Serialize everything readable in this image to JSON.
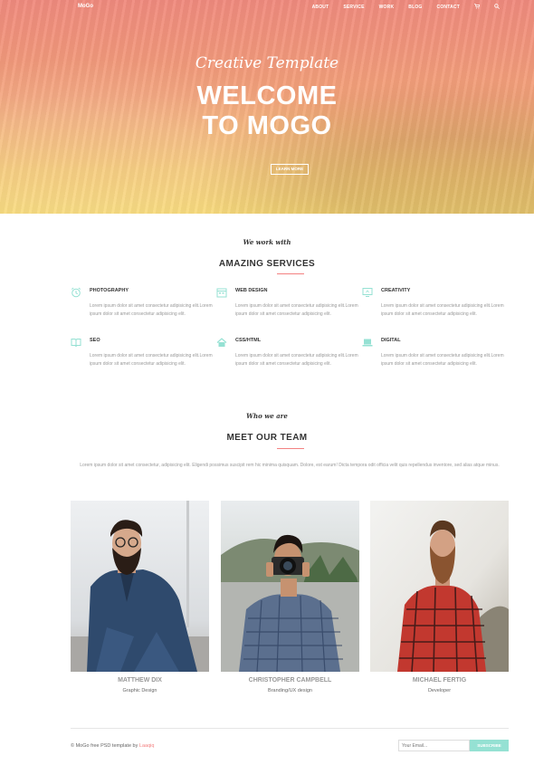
{
  "nav": {
    "logo": "MoGo",
    "items": [
      "ABOUT",
      "SERVICE",
      "WORK",
      "BLOG",
      "CONTACT"
    ],
    "cart_icon": "cart-icon",
    "search_icon": "search-icon"
  },
  "hero": {
    "script": "Creative Template",
    "title_line1": "WELCOME",
    "title_line2": "TO MOGO",
    "button": "LEARN MORE"
  },
  "services": {
    "subtitle": "We work with",
    "title": "AMAZING SERVICES",
    "items": [
      {
        "title": "PHOTOGRAPHY",
        "icon": "alarm-clock-icon",
        "desc": "Lorem ipsum dolor sit amet consectetur adipisicing elit.Lorem ipsum dolor sit amet consectetur adipisicing elit."
      },
      {
        "title": "WEB DESIGN",
        "icon": "calendar-icon",
        "desc": "Lorem ipsum dolor sit amet consectetur adipisicing elit.Lorem ipsum dolor sit amet consectetur adipisicing elit."
      },
      {
        "title": "CREATIVITY",
        "icon": "monitor-icon",
        "desc": "Lorem ipsum dolor sit amet consectetur adipisicing elit.Lorem ipsum dolor sit amet consectetur adipisicing elit."
      },
      {
        "title": "SEO",
        "icon": "book-icon",
        "desc": "Lorem ipsum dolor sit amet consectetur adipisicing elit.Lorem ipsum dolor sit amet consectetur adipisicing elit."
      },
      {
        "title": "CSS/HTML",
        "icon": "home-icon",
        "desc": "Lorem ipsum dolor sit amet consectetur adipisicing elit.Lorem ipsum dolor sit amet consectetur adipisicing elit."
      },
      {
        "title": "DIGITAL",
        "icon": "laptop-icon",
        "desc": "Lorem ipsum dolor sit amet consectetur adipisicing elit.Lorem ipsum dolor sit amet consectetur adipisicing elit."
      }
    ]
  },
  "team": {
    "subtitle": "Who we are",
    "title": "MEET OUR TEAM",
    "desc": "Lorem ipsum dolor sit amet consectetur, adipisicing elit. Eligendi possimus suscipit rem hic minima quisquam. Dolore, est earum! Dicta tempora odit officia velit quis repellendus inventore, sed alias atque minus.",
    "members": [
      {
        "name": "MATTHEW DIX",
        "role": "Graphic Design"
      },
      {
        "name": "CHRISTOPHER CAMPBELL",
        "role": "Branding/UX design"
      },
      {
        "name": "MICHAEL FERTIG",
        "role": "Developer"
      }
    ]
  },
  "footer": {
    "copyright_text": "© MoGo free PSD template by",
    "copyright_brand": "Laaqiq",
    "email_placeholder": "Your Email...",
    "subscribe": "SUBSCRIBE"
  },
  "colors": {
    "accent_red": "#f38181",
    "accent_teal": "#95e1d3",
    "hero_top": "#f08a7e",
    "hero_bottom": "#f7d874"
  }
}
